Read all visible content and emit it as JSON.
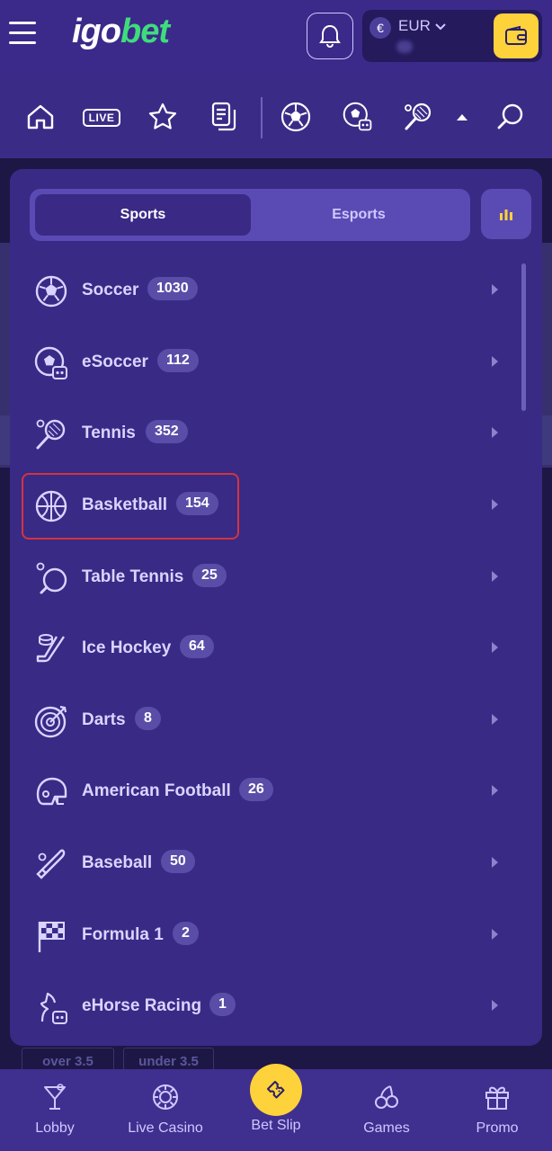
{
  "header": {
    "logo_part1": "igo",
    "logo_part2": "bet",
    "currency": "EUR",
    "currency_symbol": "€"
  },
  "nav": {
    "live_label": "LIVE"
  },
  "panel": {
    "tab_sports": "Sports",
    "tab_esports": "Esports",
    "sports": [
      {
        "name": "Soccer",
        "count": "1030"
      },
      {
        "name": "eSoccer",
        "count": "112"
      },
      {
        "name": "Tennis",
        "count": "352"
      },
      {
        "name": "Basketball",
        "count": "154"
      },
      {
        "name": "Table Tennis",
        "count": "25"
      },
      {
        "name": "Ice Hockey",
        "count": "64"
      },
      {
        "name": "Darts",
        "count": "8"
      },
      {
        "name": "American Football",
        "count": "26"
      },
      {
        "name": "Baseball",
        "count": "50"
      },
      {
        "name": "Formula 1",
        "count": "2"
      },
      {
        "name": "eHorse Racing",
        "count": "1"
      }
    ]
  },
  "background": {
    "odds_over": "over 3.5",
    "odds_under": "under 3.5"
  },
  "bottom_bar": {
    "lobby": "Lobby",
    "live_casino": "Live Casino",
    "bet_slip": "Bet Slip",
    "games": "Games",
    "promo": "Promo"
  },
  "colors": {
    "brand_green": "#3fdc7c",
    "accent_yellow": "#fdd23a",
    "highlight_red": "#d3343f"
  }
}
